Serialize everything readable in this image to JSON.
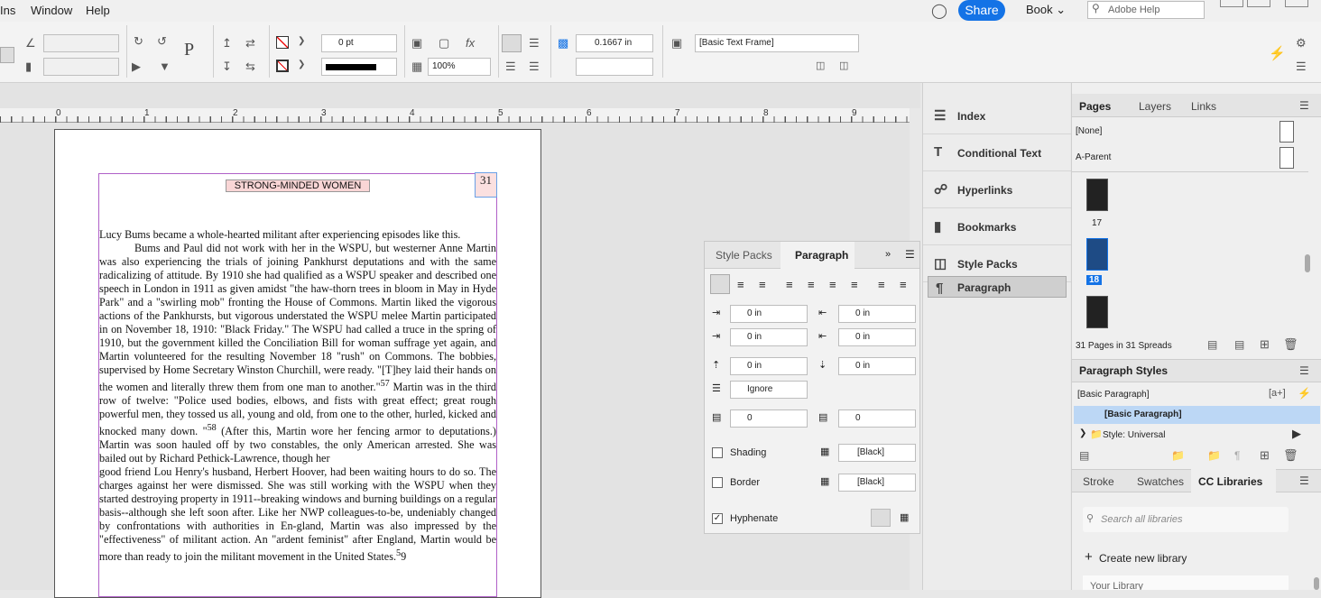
{
  "menubar": {
    "items": [
      "Ins",
      "Window",
      "Help"
    ],
    "share_label": "Share",
    "workspace_label": "Book",
    "help_search_placeholder": "Adobe Help"
  },
  "controlbar": {
    "stroke_weight": "0 pt",
    "scale": "100%",
    "gutter": "0.1667 in",
    "object_style": "[Basic Text Frame]",
    "frame_label_p": "P"
  },
  "ruler": {
    "numbers": [
      "0",
      "1",
      "2",
      "3",
      "4",
      "5",
      "6",
      "7",
      "8",
      "9"
    ]
  },
  "document": {
    "running_head": "STRONG-MINDED WOMEN",
    "page_number": "31",
    "body": [
      "Lucy Bums became a whole-hearted militant after experiencing episodes like this.",
      "Bums and Paul did not work with her in the WSPU, but westerner Anne Martin was also experiencing the trials of joining Pankhurst deputations and with the same radicalizing of attitude. By 1910 she had qualified as a WSPU speaker and described one speech in London in 1911 as given amidst \"the haw-thorn trees in bloom in May in Hyde Park\" and a \"swirling mob\" fronting the House of Commons. Martin liked the vigorous actions of the Pankhursts, but vigorous understated the WSPU melee Martin participated in on November 18, 1910: \"Black Friday.\" The WSPU had called a truce in the spring of 1910, but the government killed the Conciliation Bill for woman suffrage yet again, and Martin volunteered for the resulting November 18 \"rush\" on Commons. The bobbies, supervised by Home Secretary Winston Churchill, were ready. \"[T]hey laid their hands on the women and literally threw them from one man to another.\"",
      "57",
      " Martin was in the third row of twelve: \"Police used bodies, elbows, and fists with great effect; great rough powerful men, they tossed us all, young and old, from one to the other, hurled, kicked and knocked many down. \"",
      "58",
      " (After this, Martin wore her fencing armor to deputations.) Martin was soon hauled off by two constables, the only American arrested. She was bailed out by Richard Pethick-Lawrence, though her",
      "good friend Lou Henry's husband, Herbert Hoover, had been waiting hours to do so. The charges against her were dismissed. She was still working with the WSPU when they started destroying property in 1911--breaking windows and burning buildings on a regular basis--although she left soon after. Like her NWP colleagues-to-be, undeniably changed by confrontations with authorities in En-gland, Martin was also impressed by the \"effectiveness\" of militant action. An \"ardent feminist\" after England, Martin would be more than ready to join the militant movement in the United States.",
      "5",
      "9"
    ]
  },
  "paragraph_panel": {
    "tabs": [
      "Style Packs",
      "Paragraph"
    ],
    "left_indent": "0 in",
    "right_indent": "0 in",
    "first_line_indent": "0 in",
    "last_line_indent": "0 in",
    "space_before": "0 in",
    "space_after": "0 in",
    "align_to_grid": "Ignore",
    "drop_cap_lines": "0",
    "drop_cap_chars": "0",
    "shading_label": "Shading",
    "shading_color": "[Black]",
    "border_label": "Border",
    "border_color": "[Black]",
    "hyphenate_label": "Hyphenate"
  },
  "collapsed_panels": [
    "Index",
    "Conditional Text",
    "Hyperlinks",
    "Bookmarks",
    "Style Packs",
    "Paragraph"
  ],
  "pages_panel": {
    "tabs": [
      "Pages",
      "Layers",
      "Links"
    ],
    "none_label": "[None]",
    "parent_label": "A-Parent",
    "page_labels": [
      "17",
      "18"
    ],
    "summary": "31 Pages in 31 Spreads"
  },
  "paragraph_styles_panel": {
    "title": "Paragraph Styles",
    "current": "[Basic Paragraph]",
    "selected": "[Basic Paragraph]",
    "group": "Style: Universal"
  },
  "bottom_tabs": [
    "Stroke",
    "Swatches",
    "CC Libraries"
  ],
  "cc_libraries": {
    "search_placeholder": "Search all libraries",
    "create_label": "Create new library",
    "your_library": "Your Library"
  },
  "colors": {
    "accent": "#1473e6",
    "frame": "#b060c8",
    "selection": "#bcd7f5"
  }
}
